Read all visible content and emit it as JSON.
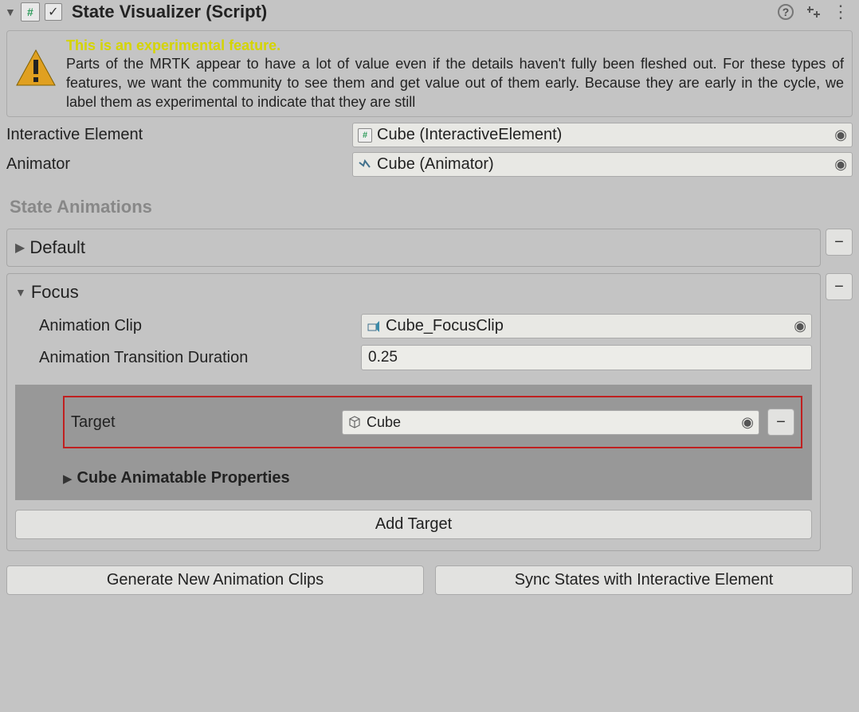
{
  "header": {
    "title": "State Visualizer (Script)",
    "enabled_checked": "✓"
  },
  "warning": {
    "title": "This is an experimental feature.",
    "body": "Parts of the MRTK appear to have a lot of value even if the details haven't fully been fleshed out. For these types of features, we want the community to see them and get value out of them early. Because they are early in the cycle, we label them as experimental to indicate that they are still"
  },
  "fields": {
    "interactive_element_label": "Interactive Element",
    "interactive_element_value": "Cube (InteractiveElement)",
    "animator_label": "Animator",
    "animator_value": "Cube (Animator)"
  },
  "section_title": "State Animations",
  "states": {
    "default": {
      "name": "Default"
    },
    "focus": {
      "name": "Focus",
      "clip_label": "Animation Clip",
      "clip_value": "Cube_FocusClip",
      "duration_label": "Animation Transition Duration",
      "duration_value": "0.25",
      "target_label": "Target",
      "target_value": "Cube",
      "anim_props_label": "Cube Animatable Properties",
      "add_target_label": "Add Target"
    }
  },
  "buttons": {
    "remove": "−",
    "generate": "Generate New Animation Clips",
    "sync": "Sync States with Interactive Element"
  },
  "glyphs": {
    "tri_down": "▼",
    "tri_right": "▶",
    "ring": "◉",
    "help": "?",
    "preset": "⇅",
    "menu": "⋮"
  }
}
